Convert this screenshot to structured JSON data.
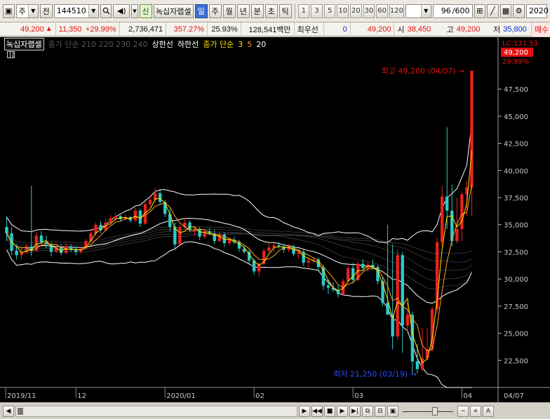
{
  "toolbar": {
    "market_label": "주",
    "prev_label": "전",
    "stock_code": "144510",
    "group_badge": "신",
    "stock_name": "녹십자랩셀",
    "periods": [
      "일",
      "주",
      "월",
      "년",
      "분",
      "초",
      "틱"
    ],
    "selected_period": "일",
    "intervals": [
      "1",
      "3",
      "5",
      "10",
      "20",
      "30",
      "60",
      "120"
    ],
    "count_value": "96",
    "count_total": "/600",
    "year_value": "2020"
  },
  "quote": {
    "price": "49,200",
    "change": "11,350",
    "change_pct": "+29.99%",
    "volume": "2,736,471",
    "volume_ratio": "357.27%",
    "turnover": "25.93%",
    "trade_value": "128,541백만",
    "preferred_label": "최우선",
    "preferred_value": "0",
    "current": "49,200",
    "open_label": "시",
    "open": "38,450",
    "high_label": "고",
    "high": "49,200",
    "low_label": "저",
    "low": "35,800",
    "sell_label": "매수"
  },
  "legend": {
    "name": "녹십자랩셀",
    "ma_long": "종가 단순 210 220 230 240",
    "upper_limit": "상한선",
    "lower_limit": "하한선",
    "ma_short_label": "종가 단순",
    "ma3": "3",
    "ma5": "5",
    "ma20": "20"
  },
  "chart_data": {
    "type": "candlestick",
    "y_range": [
      20000,
      51000
    ],
    "y_ticks": [
      "47,500",
      "45,000",
      "42,500",
      "40,000",
      "37,500",
      "35,000",
      "32,500",
      "30,000",
      "27,500",
      "25,000",
      "22,500"
    ],
    "y_tick_values": [
      47500,
      45000,
      42500,
      40000,
      37500,
      35000,
      32500,
      30000,
      27500,
      25000,
      22500
    ],
    "lc_label": "LC:131.53",
    "last_price_label": "49,200",
    "last_pct_label": "29.99%",
    "x_labels": [
      "2019/11",
      "12",
      "2020/01",
      "02",
      "03",
      "04",
      "04/07"
    ],
    "max_annotation": "최고 49,200 (04/07)",
    "min_annotation": "최저 21,250 (03/19)",
    "colors": {
      "up": "#e8221b",
      "down": "#2fc9c9",
      "ma3": "#ffe100",
      "ma5": "#ff9d2a",
      "band": "#ffffff",
      "long_ma": "#5a5a5a"
    },
    "candles": [
      [
        34800,
        35800,
        33500,
        34200
      ],
      [
        34200,
        34800,
        32200,
        32600
      ],
      [
        32600,
        33200,
        31800,
        32200
      ],
      [
        32200,
        32800,
        31800,
        32500
      ],
      [
        32500,
        33200,
        32300,
        33000
      ],
      [
        33000,
        38600,
        32100,
        32600
      ],
      [
        32600,
        34300,
        32500,
        34000
      ],
      [
        34000,
        34400,
        33200,
        33400
      ],
      [
        33400,
        34000,
        32800,
        33200
      ],
      [
        33200,
        33400,
        32100,
        32500
      ],
      [
        32500,
        33100,
        32400,
        32900
      ],
      [
        32900,
        33200,
        32200,
        32400
      ],
      [
        32400,
        33300,
        32300,
        33000
      ],
      [
        33000,
        33200,
        32500,
        32700
      ],
      [
        32700,
        33000,
        32200,
        32500
      ],
      [
        32500,
        32900,
        32300,
        32800
      ],
      [
        32800,
        33700,
        32700,
        33500
      ],
      [
        33500,
        34500,
        33400,
        34200
      ],
      [
        34200,
        35200,
        34000,
        35000
      ],
      [
        35000,
        35300,
        34200,
        34500
      ],
      [
        34500,
        35500,
        34400,
        35200
      ],
      [
        35200,
        35900,
        35000,
        35600
      ],
      [
        35600,
        36100,
        35300,
        35800
      ],
      [
        35800,
        35900,
        35300,
        35500
      ],
      [
        35500,
        36000,
        35400,
        35700
      ],
      [
        35700,
        35800,
        35200,
        35400
      ],
      [
        35400,
        36600,
        35300,
        36300
      ],
      [
        36300,
        36500,
        34800,
        35100
      ],
      [
        35100,
        37200,
        35000,
        36900
      ],
      [
        36900,
        37600,
        36600,
        37300
      ],
      [
        37300,
        38400,
        37000,
        37900
      ],
      [
        37900,
        38200,
        36900,
        37100
      ],
      [
        37100,
        37300,
        35700,
        36000
      ],
      [
        36000,
        36500,
        34400,
        34800
      ],
      [
        34800,
        35200,
        32800,
        33200
      ],
      [
        33200,
        35000,
        33100,
        34800
      ],
      [
        34800,
        35600,
        34600,
        35200
      ],
      [
        35200,
        35400,
        34300,
        34500
      ],
      [
        34500,
        34900,
        34000,
        34600
      ],
      [
        34600,
        34800,
        33600,
        33900
      ],
      [
        33900,
        34500,
        33700,
        34400
      ],
      [
        34400,
        34700,
        34000,
        34200
      ],
      [
        34200,
        34500,
        33200,
        33500
      ],
      [
        33500,
        34400,
        33400,
        34100
      ],
      [
        34100,
        34300,
        33000,
        33300
      ],
      [
        33300,
        33800,
        33100,
        33600
      ],
      [
        33600,
        33900,
        33200,
        33400
      ],
      [
        33400,
        33600,
        32500,
        32800
      ],
      [
        32800,
        33200,
        32300,
        32500
      ],
      [
        32500,
        32700,
        31400,
        31700
      ],
      [
        31700,
        31900,
        30400,
        30700
      ],
      [
        30700,
        31600,
        30200,
        31400
      ],
      [
        31400,
        32800,
        31300,
        32600
      ],
      [
        32600,
        33300,
        32400,
        32900
      ],
      [
        32900,
        33300,
        32500,
        33100
      ],
      [
        33100,
        33400,
        32800,
        33000
      ],
      [
        33000,
        33200,
        32400,
        32700
      ],
      [
        32700,
        33200,
        32500,
        33000
      ],
      [
        33000,
        33200,
        32100,
        32300
      ],
      [
        32300,
        32700,
        31900,
        32500
      ],
      [
        32500,
        32700,
        31200,
        31500
      ],
      [
        31500,
        32000,
        31100,
        31700
      ],
      [
        31700,
        32000,
        31400,
        31800
      ],
      [
        31800,
        32000,
        30800,
        31100
      ],
      [
        31100,
        31300,
        29000,
        29400
      ],
      [
        29400,
        29900,
        28600,
        29200
      ],
      [
        29200,
        29700,
        28800,
        29000
      ],
      [
        29000,
        29500,
        28300,
        28600
      ],
      [
        28600,
        30000,
        28500,
        29800
      ],
      [
        29800,
        31200,
        29700,
        31000
      ],
      [
        31000,
        31500,
        29600,
        29900
      ],
      [
        29900,
        31600,
        29800,
        31400
      ],
      [
        31400,
        31800,
        30800,
        31000
      ],
      [
        31000,
        31600,
        30700,
        31300
      ],
      [
        31300,
        31800,
        30900,
        31100
      ],
      [
        31100,
        31300,
        29500,
        29800
      ],
      [
        29800,
        30200,
        27500,
        27800
      ],
      [
        27800,
        35000,
        27000,
        26700
      ],
      [
        26700,
        33200,
        23500,
        24700
      ],
      [
        24700,
        32700,
        24400,
        32200
      ],
      [
        32200,
        32500,
        23200,
        25700
      ],
      [
        25700,
        27800,
        25000,
        26700
      ],
      [
        26700,
        27000,
        21250,
        22400
      ],
      [
        22400,
        24000,
        21300,
        21700
      ],
      [
        21700,
        25500,
        21500,
        22700
      ],
      [
        22700,
        25500,
        22500,
        23500
      ],
      [
        23500,
        27500,
        23300,
        27200
      ],
      [
        27200,
        33800,
        26800,
        33400
      ],
      [
        33400,
        38600,
        33000,
        37600
      ],
      [
        37600,
        44000,
        34600,
        36300
      ],
      [
        36300,
        38700,
        33000,
        33500
      ],
      [
        33500,
        37500,
        33300,
        34600
      ],
      [
        34600,
        38000,
        33500,
        37800
      ],
      [
        37800,
        39000,
        35800,
        38450
      ],
      [
        38450,
        49200,
        35800,
        49200
      ]
    ]
  },
  "scroll": {
    "zoom_minus": "−",
    "zoom_plus": "+",
    "font_label": "A"
  }
}
